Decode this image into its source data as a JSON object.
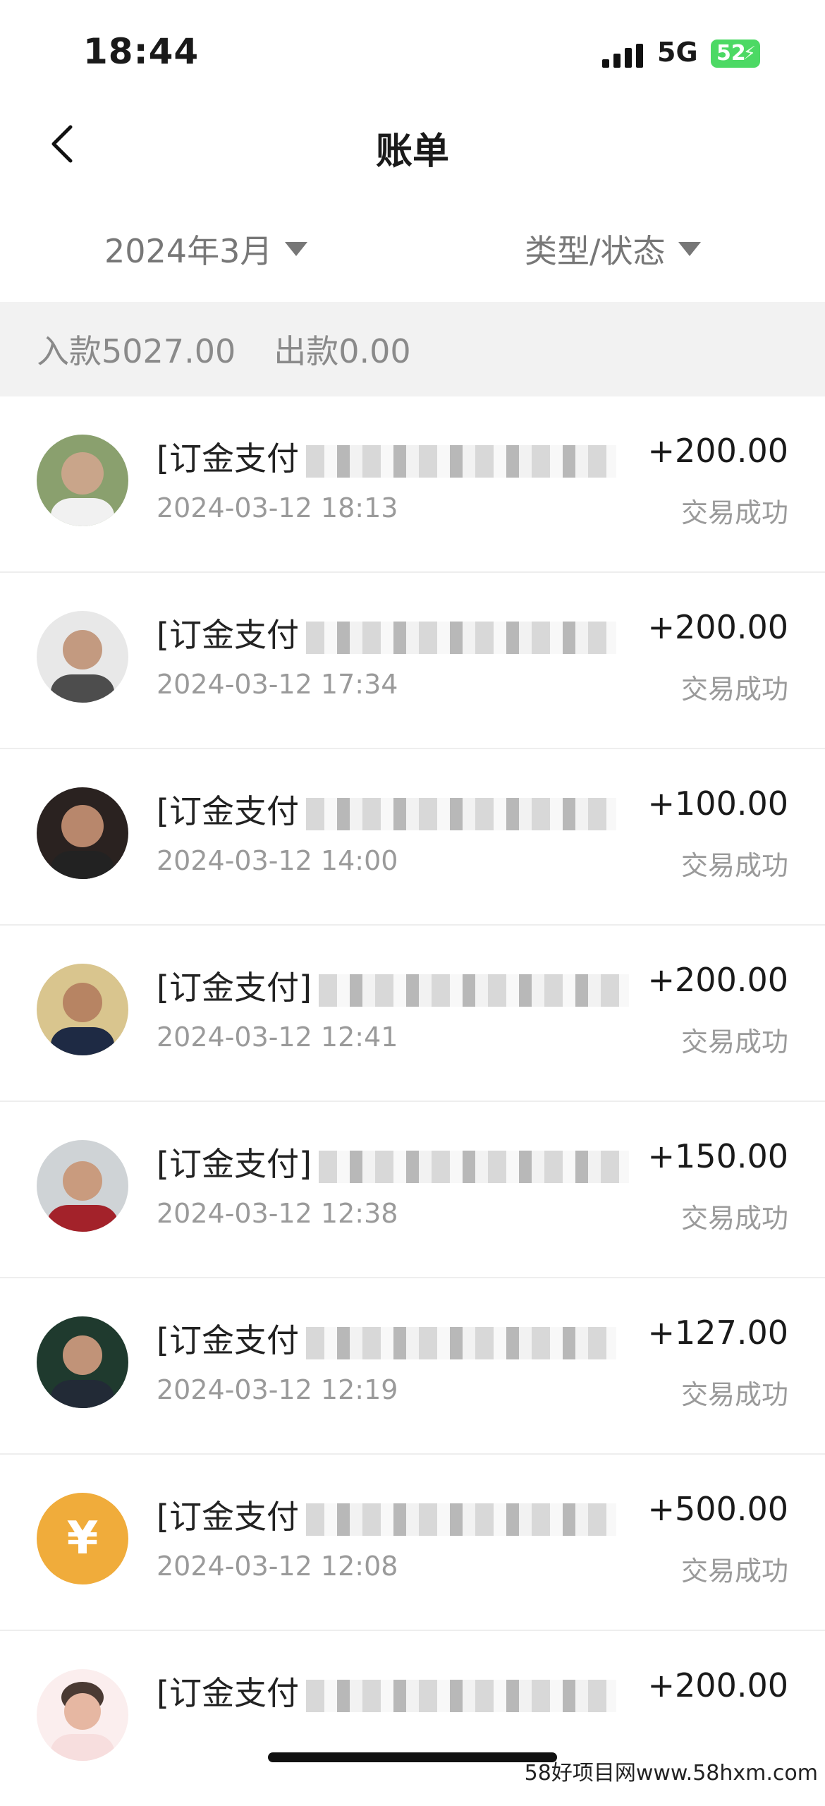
{
  "status_bar": {
    "time": "18:44",
    "network": "5G",
    "battery": "52"
  },
  "nav": {
    "title": "账单"
  },
  "filters": {
    "month": "2024年3月",
    "type": "类型/状态"
  },
  "summary": {
    "income": "入款5027.00",
    "expense": "出款0.00"
  },
  "transactions": [
    {
      "desc": "[订金支付",
      "date": "2024-03-12 18:13",
      "amount": "+200.00",
      "status": "交易成功",
      "avatar": "person-photo"
    },
    {
      "desc": "[订金支付",
      "date": "2024-03-12 17:34",
      "amount": "+200.00",
      "status": "交易成功",
      "avatar": "person-photo"
    },
    {
      "desc": "[订金支付",
      "date": "2024-03-12 14:00",
      "amount": "+100.00",
      "status": "交易成功",
      "avatar": "person-photo"
    },
    {
      "desc": "[订金支付]",
      "date": "2024-03-12 12:41",
      "amount": "+200.00",
      "status": "交易成功",
      "avatar": "person-photo"
    },
    {
      "desc": "[订金支付]",
      "date": "2024-03-12 12:38",
      "amount": "+150.00",
      "status": "交易成功",
      "avatar": "person-photo"
    },
    {
      "desc": "[订金支付",
      "date": "2024-03-12 12:19",
      "amount": "+127.00",
      "status": "交易成功",
      "avatar": "person-photo"
    },
    {
      "desc": "[订金支付",
      "date": "2024-03-12 12:08",
      "amount": "+500.00",
      "status": "交易成功",
      "avatar": "yuan-icon"
    },
    {
      "desc": "[订金支付",
      "date": "",
      "amount": "+200.00",
      "status": "",
      "avatar": "person-photo"
    }
  ],
  "watermark": "58好项目网www.58hxm.com",
  "colors": {
    "battery": "#4cd964",
    "yuan_icon_bg": "#f0ac3b"
  }
}
